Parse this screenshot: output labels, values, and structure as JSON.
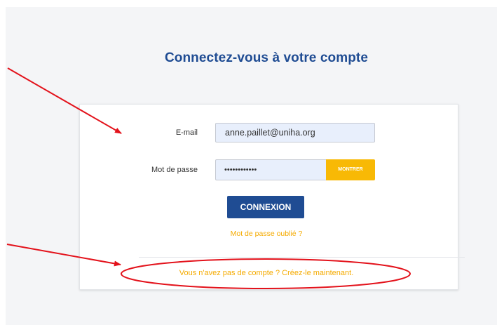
{
  "login": {
    "title": "Connectez-vous à votre compte",
    "email": {
      "label": "E-mail",
      "value": "anne.paillet@uniha.org"
    },
    "password": {
      "label": "Mot de passe",
      "value": "••••••••••••"
    },
    "show_label": "MONTRER",
    "submit_label": "CONNEXION",
    "forgot_link": "Mot de passe oublié ?",
    "signup_link": "Vous n'avez pas de compte ? Créez-le maintenant."
  },
  "colors": {
    "primary": "#1f4c93",
    "accent": "#f8b905",
    "link": "#f5ab00",
    "annotation": "#e3121b",
    "input_bg": "#e8effc",
    "page_bg": "#f4f5f7"
  },
  "icons": {
    "arrow": "arrow-annotation-icon",
    "ellipse": "ellipse-highlight-icon"
  }
}
